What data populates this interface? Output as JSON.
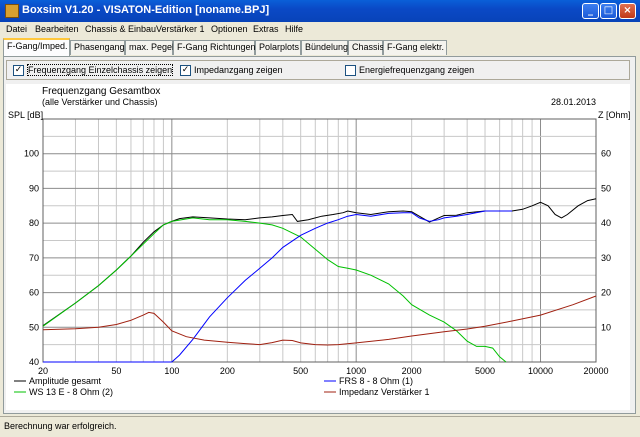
{
  "window": {
    "title": "Boxsim V1.20 - VISATON-Edition [noname.BPJ]",
    "buttons": [
      "minimize",
      "maximize",
      "close"
    ]
  },
  "menu": [
    "Datei",
    "Bearbeiten",
    "Chassis & Einbau",
    "Verstärker 1",
    "Optionen",
    "Extras",
    "Hilfe"
  ],
  "tabs": [
    {
      "label": "F-Gang/Imped.",
      "active": true
    },
    {
      "label": "Phasengang",
      "active": false
    },
    {
      "label": "max. Pegel",
      "active": false
    },
    {
      "label": "F-Gang Richtungen",
      "active": false
    },
    {
      "label": "Polarplots",
      "active": false
    },
    {
      "label": "Bündelung",
      "active": false
    },
    {
      "label": "Chassis",
      "active": false
    },
    {
      "label": "F-Gang elektr.",
      "active": false
    }
  ],
  "checkboxes": [
    {
      "label": "Frequenzgang Einzelchassis zeigen",
      "checked": true
    },
    {
      "label": "Impedanzgang zeigen",
      "checked": true
    },
    {
      "label": "Energiefrequenzgang zeigen",
      "checked": false
    }
  ],
  "chart_data": {
    "type": "line",
    "title": "Frequenzgang Gesamtbox",
    "subtitle": "(alle Verstärker und Chassis)",
    "date": "28.01.2013",
    "ylabel": "SPL [dB]",
    "y2label": "Z [Ohm]",
    "xscale": "log",
    "xlim": [
      20,
      20000
    ],
    "ylim": [
      40,
      110
    ],
    "y2lim": [
      0,
      70
    ],
    "x_ticks": [
      "20",
      "50",
      "100",
      "200",
      "500",
      "1000",
      "2000",
      "5000",
      "10000",
      "20000"
    ],
    "y_ticks": [
      "40",
      "50",
      "60",
      "70",
      "80",
      "90",
      "100"
    ],
    "y2_ticks": [
      "10",
      "20",
      "30",
      "40",
      "50",
      "60"
    ],
    "grid": true,
    "legend_position": "bottom",
    "series": [
      {
        "name": "Amplitude gesamt",
        "color": "#000000",
        "axis": "left",
        "points": [
          [
            20,
            50.5
          ],
          [
            30,
            57
          ],
          [
            40,
            62
          ],
          [
            50,
            66.5
          ],
          [
            60,
            70.5
          ],
          [
            70,
            74.5
          ],
          [
            80,
            77.5
          ],
          [
            90,
            79.5
          ],
          [
            100,
            80.5
          ],
          [
            110,
            81.3
          ],
          [
            130,
            81.8
          ],
          [
            160,
            81.5
          ],
          [
            200,
            81.2
          ],
          [
            250,
            81
          ],
          [
            300,
            81.5
          ],
          [
            350,
            81.8
          ],
          [
            400,
            82.2
          ],
          [
            450,
            82.5
          ],
          [
            480,
            80.5
          ],
          [
            550,
            81
          ],
          [
            650,
            82
          ],
          [
            750,
            82.5
          ],
          [
            850,
            83
          ],
          [
            900,
            83.5
          ],
          [
            1000,
            83
          ],
          [
            1200,
            82.5
          ],
          [
            1500,
            83.3
          ],
          [
            1800,
            83.5
          ],
          [
            2000,
            83.3
          ],
          [
            2200,
            82
          ],
          [
            2500,
            80.3
          ],
          [
            2800,
            81.5
          ],
          [
            3000,
            82.2
          ],
          [
            3500,
            82.3
          ],
          [
            4000,
            83
          ],
          [
            5000,
            83.5
          ],
          [
            6000,
            83.5
          ],
          [
            7000,
            83.5
          ],
          [
            8000,
            84
          ],
          [
            9000,
            85
          ],
          [
            10000,
            86
          ],
          [
            11000,
            85
          ],
          [
            12000,
            82.5
          ],
          [
            13000,
            81.5
          ],
          [
            14000,
            82.5
          ],
          [
            16000,
            85
          ],
          [
            18000,
            86.5
          ],
          [
            20000,
            87
          ]
        ]
      },
      {
        "name": "WS 13 E - 8 Ohm (2)",
        "color": "#00c000",
        "axis": "left",
        "points": [
          [
            20,
            50.3
          ],
          [
            30,
            57
          ],
          [
            40,
            62
          ],
          [
            50,
            66.5
          ],
          [
            60,
            70.5
          ],
          [
            70,
            74
          ],
          [
            80,
            77
          ],
          [
            90,
            79.5
          ],
          [
            100,
            80.5
          ],
          [
            130,
            81.5
          ],
          [
            160,
            81
          ],
          [
            200,
            81
          ],
          [
            250,
            80.5
          ],
          [
            300,
            80
          ],
          [
            350,
            79.5
          ],
          [
            400,
            78.5
          ],
          [
            500,
            76
          ],
          [
            600,
            72.5
          ],
          [
            700,
            69.5
          ],
          [
            800,
            67.5
          ],
          [
            900,
            67
          ],
          [
            1000,
            66.5
          ],
          [
            1200,
            65
          ],
          [
            1500,
            62.5
          ],
          [
            1800,
            59
          ],
          [
            2000,
            56.5
          ],
          [
            2500,
            53.5
          ],
          [
            3000,
            51.5
          ],
          [
            3500,
            49
          ],
          [
            4000,
            46
          ],
          [
            4500,
            44.5
          ],
          [
            5000,
            44.5
          ],
          [
            5500,
            44
          ],
          [
            6000,
            41.5
          ],
          [
            6500,
            40
          ]
        ]
      },
      {
        "name": "FRS 8 - 8 Ohm (1)",
        "color": "#0000ff",
        "axis": "left",
        "points": [
          [
            20,
            40
          ],
          [
            100,
            40
          ],
          [
            110,
            42
          ],
          [
            130,
            46.5
          ],
          [
            160,
            53
          ],
          [
            200,
            58.5
          ],
          [
            250,
            63.5
          ],
          [
            300,
            67
          ],
          [
            350,
            70
          ],
          [
            400,
            73
          ],
          [
            500,
            76.5
          ],
          [
            600,
            78.5
          ],
          [
            700,
            80
          ],
          [
            800,
            81
          ],
          [
            900,
            82
          ],
          [
            1000,
            82.5
          ],
          [
            1200,
            82
          ],
          [
            1500,
            82.8
          ],
          [
            1800,
            83
          ],
          [
            2000,
            83
          ],
          [
            2200,
            81.5
          ],
          [
            2500,
            80.5
          ],
          [
            2800,
            81
          ],
          [
            3000,
            81.5
          ],
          [
            3500,
            82
          ],
          [
            4000,
            82.5
          ],
          [
            5000,
            83.5
          ],
          [
            6000,
            83.5
          ],
          [
            7000,
            83.5
          ]
        ]
      },
      {
        "name": "Impedanz Verstärker 1",
        "color": "#a02010",
        "axis": "right",
        "points": [
          [
            20,
            9.3
          ],
          [
            30,
            9.6
          ],
          [
            40,
            10
          ],
          [
            50,
            10.8
          ],
          [
            60,
            12
          ],
          [
            70,
            13.5
          ],
          [
            75,
            14.3
          ],
          [
            80,
            14
          ],
          [
            90,
            11.5
          ],
          [
            100,
            9
          ],
          [
            120,
            7.3
          ],
          [
            150,
            6.3
          ],
          [
            200,
            5.7
          ],
          [
            250,
            5.3
          ],
          [
            300,
            5
          ],
          [
            350,
            5.6
          ],
          [
            400,
            6.3
          ],
          [
            450,
            6.2
          ],
          [
            500,
            5.5
          ],
          [
            600,
            5
          ],
          [
            700,
            4.9
          ],
          [
            800,
            5
          ],
          [
            1000,
            5.5
          ],
          [
            1500,
            6.5
          ],
          [
            2000,
            7.5
          ],
          [
            3000,
            8.7
          ],
          [
            4000,
            9.5
          ],
          [
            5000,
            10.3
          ],
          [
            7000,
            11.8
          ],
          [
            10000,
            13.5
          ],
          [
            15000,
            16.5
          ],
          [
            20000,
            19
          ]
        ]
      }
    ]
  },
  "status": {
    "text": "Berechnung war erfolgreich."
  }
}
